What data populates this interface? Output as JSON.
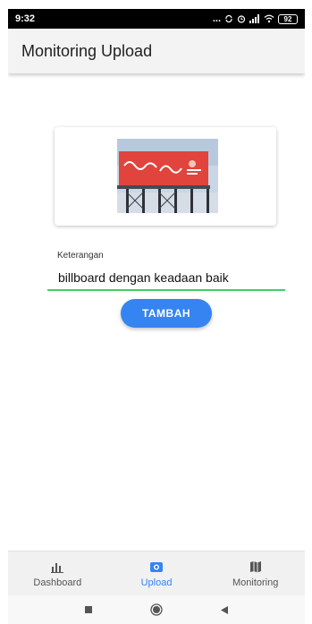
{
  "status_bar": {
    "time": "9:32",
    "dots": "...",
    "battery": "92"
  },
  "app_bar": {
    "title": "Monitoring Upload"
  },
  "upload_form": {
    "field_label": "Keterangan",
    "field_value": "billboard dengan keadaan baik",
    "submit_label": "TAMBAH"
  },
  "bottom_nav": {
    "items": [
      {
        "label": "Dashboard",
        "icon": "bar-chart-icon",
        "active": false
      },
      {
        "label": "Upload",
        "icon": "camera-icon",
        "active": true
      },
      {
        "label": "Monitoring",
        "icon": "map-icon",
        "active": false
      }
    ]
  },
  "colors": {
    "accent": "#3584f2",
    "input_underline": "#3fcf6a",
    "billboard_red": "#e0443c"
  }
}
